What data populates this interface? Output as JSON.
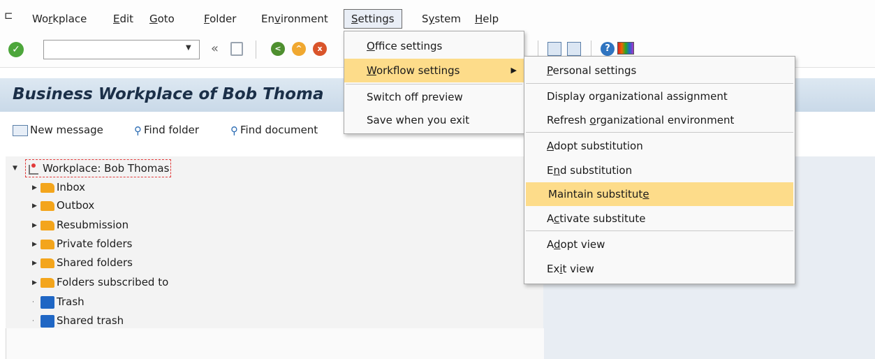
{
  "menubar": {
    "items": [
      {
        "key": "workplace",
        "pre": "Wo",
        "ul": "r",
        "post": "kplace"
      },
      {
        "key": "edit",
        "pre": "",
        "ul": "E",
        "post": "dit"
      },
      {
        "key": "goto",
        "pre": "",
        "ul": "G",
        "post": "oto"
      },
      {
        "key": "folder",
        "pre": "",
        "ul": "F",
        "post": "older"
      },
      {
        "key": "environment",
        "pre": "En",
        "ul": "v",
        "post": "ironment"
      },
      {
        "key": "settings",
        "pre": "",
        "ul": "S",
        "post": "ettings"
      },
      {
        "key": "system",
        "pre": "S",
        "ul": "y",
        "post": "stem"
      },
      {
        "key": "help",
        "pre": "",
        "ul": "H",
        "post": "elp"
      }
    ]
  },
  "toolbar": {
    "ok_glyph": "✓",
    "dropdown_glyph": "▼",
    "back_glyph": "«",
    "help_glyph": "?",
    "icons": [
      "ok-icon",
      "save-icon",
      "back-icon",
      "exit-icon",
      "cancel-icon",
      "layout-icon",
      "help-icon",
      "color-icon"
    ]
  },
  "title": "Business Workplace of Bob Thoma",
  "app_toolbar": {
    "new_message": "New message",
    "find_folder": "Find folder",
    "find_document": "Find document"
  },
  "tree": {
    "root": "Workplace: Bob Thomas",
    "items": [
      "Inbox",
      "Outbox",
      "Resubmission",
      "Private folders",
      "Shared folders",
      "Folders subscribed to",
      "Trash",
      "Shared trash"
    ]
  },
  "settings_menu": {
    "office": {
      "pre": "",
      "ul": "O",
      "post": "ffice settings"
    },
    "workflow": {
      "pre": "",
      "ul": "W",
      "post": "orkflow settings"
    },
    "switch_off_preview": "Switch off preview",
    "save_when_exit": "Save when you exit",
    "submenu_arrow": "▶"
  },
  "workflow_submenu": {
    "personal": {
      "pre": "",
      "ul": "P",
      "post": "ersonal settings"
    },
    "display_org": {
      "pre": "Display or",
      "ul": "g",
      "post": "anizational assignment"
    },
    "refresh_org": {
      "pre": "Refresh ",
      "ul": "o",
      "post": "rganizational environment"
    },
    "adopt_substitution": {
      "pre": "",
      "ul": "A",
      "post": "dopt substitution"
    },
    "end_substitution": {
      "pre": "E",
      "ul": "n",
      "post": "d substitution"
    },
    "maintain_substitute": {
      "pre": "Maintain substitut",
      "ul": "e",
      "post": ""
    },
    "activate_substitute": {
      "pre": "A",
      "ul": "c",
      "post": "tivate substitute"
    },
    "adopt_view": {
      "pre": "A",
      "ul": "d",
      "post": "opt view"
    },
    "exit_view": {
      "pre": "Ex",
      "ul": "i",
      "post": "t view"
    }
  },
  "colors": {
    "menu_highlight": "#fddc8a",
    "title_text": "#1b2f48",
    "folder": "#f3a51c",
    "trash": "#1f66c4"
  }
}
